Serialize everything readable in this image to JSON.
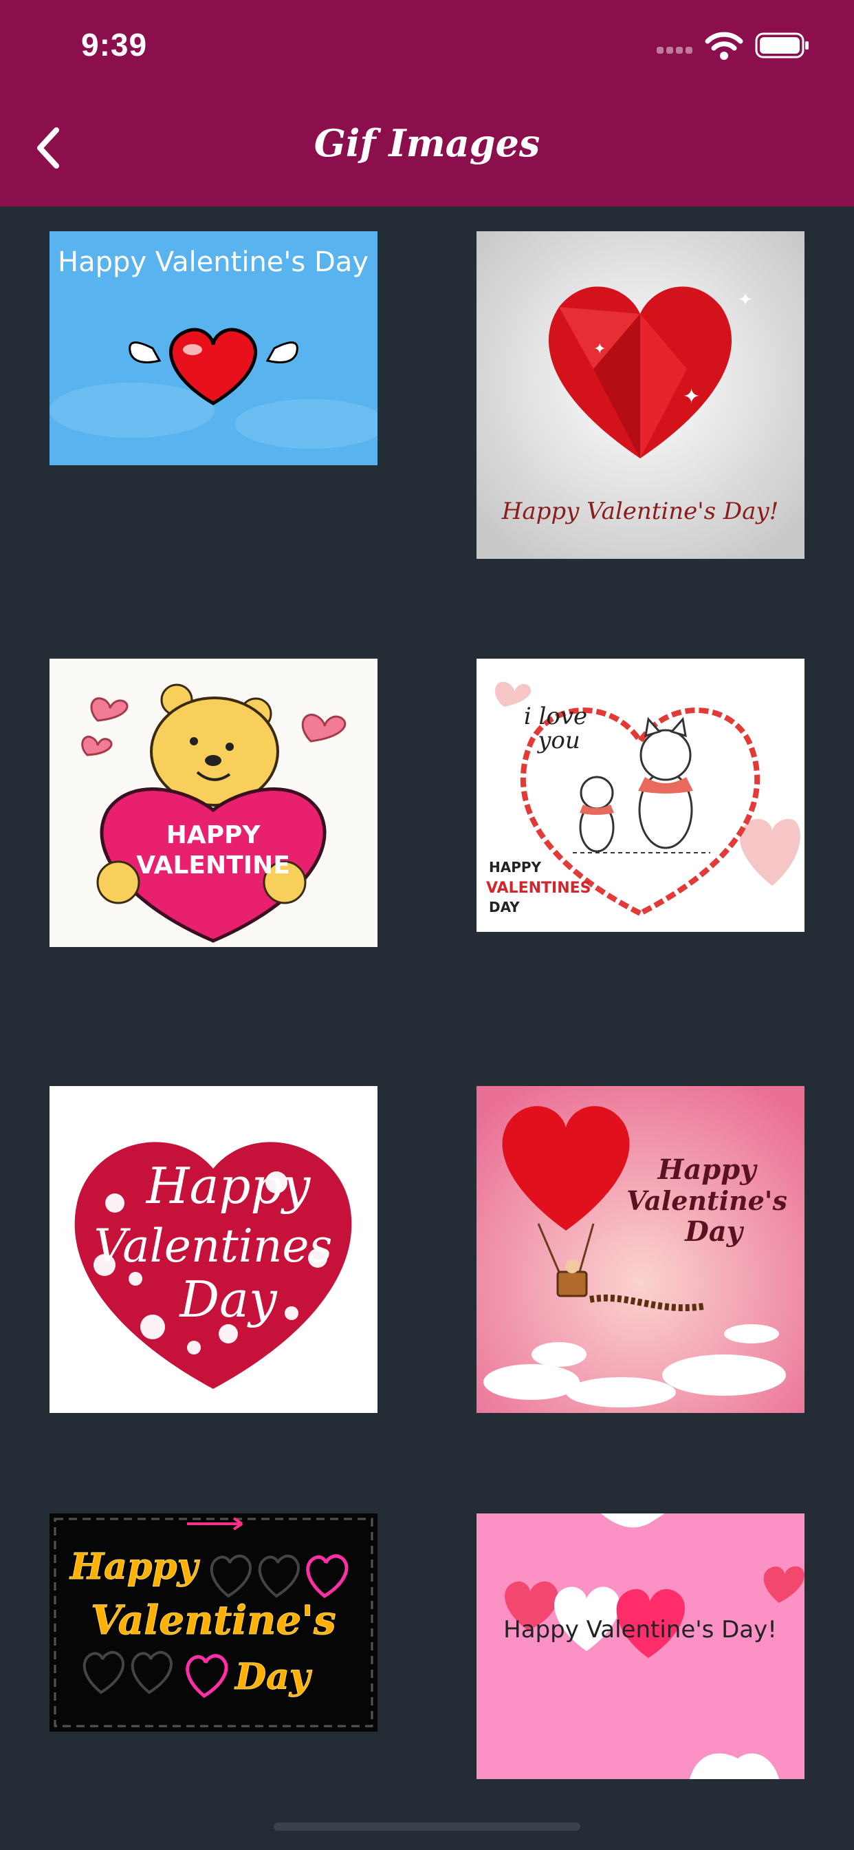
{
  "status_bar": {
    "time": "9:39"
  },
  "header": {
    "title": "Gif Images",
    "back_icon": "chevron-left-icon"
  },
  "colors": {
    "header": "#8b0f4c",
    "background": "#242d35"
  },
  "gallery": [
    {
      "text": "Happy Valentine's Day"
    },
    {
      "text": "Happy Valentine's Day!"
    },
    {
      "text_line1": "HAPPY",
      "text_line2": "VALENTINE"
    },
    {
      "title_line1": "i love",
      "title_line2": "you",
      "caption_line1": "HAPPY",
      "caption_line2": "VALENTINES",
      "caption_line3": "DAY"
    },
    {
      "text_line1": "Happy",
      "text_line2": "Valentines",
      "text_line3": "Day"
    },
    {
      "text_line1": "Happy",
      "text_line2": "Valentine's",
      "text_line3": "Day"
    },
    {
      "text_line1": "Happy",
      "text_line2": "Valentine's",
      "text_line3": "Day"
    },
    {
      "text": "Happy Valentine's Day!"
    }
  ]
}
